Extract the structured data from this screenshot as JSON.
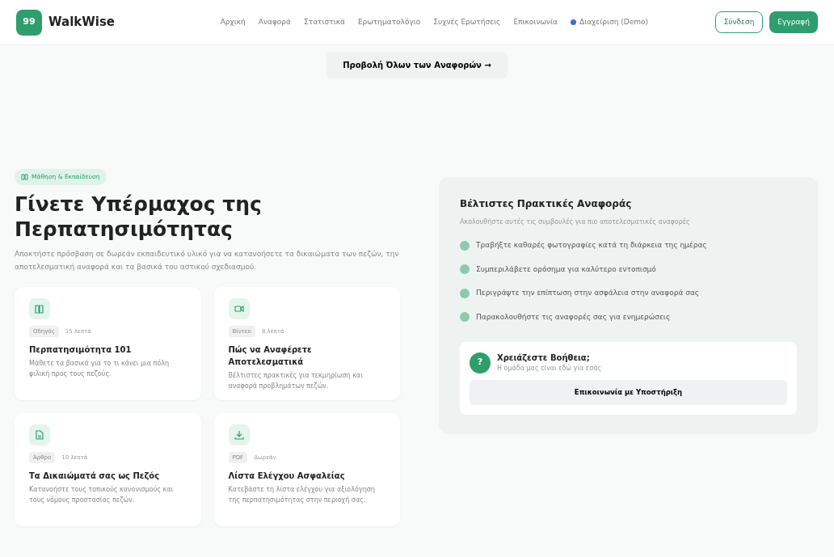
{
  "brand": {
    "name": "WalkWise",
    "logo_text": "99"
  },
  "nav": [
    {
      "label": "Αρχική",
      "selected": false
    },
    {
      "label": "Αναφορά",
      "selected": false
    },
    {
      "label": "Στατιστικά",
      "selected": false
    },
    {
      "label": "Ερωτηματολόγιο",
      "selected": false
    },
    {
      "label": "Συχνές Ερωτήσεις",
      "selected": false
    },
    {
      "label": "Επικοινωνία",
      "selected": false
    },
    {
      "label": "Διαχείριση (Demo)",
      "selected": false,
      "kind": "demo"
    }
  ],
  "auth_buttons": [
    {
      "label": "Σύνδεση",
      "kind": "outline"
    },
    {
      "label": "Εγγραφή",
      "kind": "solid"
    }
  ],
  "view_all_button": "Προβολή Όλων των Αναφορών →",
  "learn": {
    "badge": "Μάθηση & Εκπαίδευση",
    "title": "Γίνετε Υπέρμαχος της Περπατησιμότητας",
    "description": "Αποκτήστε πρόσβαση σε δωρεάν εκπαιδευτικό υλικό για να κατανοήσετε τα δικαιώματα των πεζών, την αποτελεσματική αναφορά και τα βασικά του αστικού σχεδιασμού.",
    "resources": [
      {
        "kind": "book",
        "tag": "Οδηγός",
        "meta": "15 λεπτά",
        "title": "Περπατησιμότητα 101",
        "description": "Μάθετε τα βασικά για το τι κάνει μια πόλη φιλική προς τους πεζούς."
      },
      {
        "kind": "video",
        "tag": "Βίντεο",
        "meta": "8 λεπτά",
        "title": "Πώς να Αναφέρετε Αποτελεσματικά",
        "description": "Βέλτιστες πρακτικές για τεκμηρίωση και αναφορά προβλημάτων πεζών."
      },
      {
        "kind": "document",
        "tag": "Άρθρο",
        "meta": "10 λεπτά",
        "title": "Τα Δικαιώματά σας ως Πεζός",
        "description": "Κατανοήστε τους τοπικούς κανονισμούς και τους νόμους προστασίας πεζών."
      },
      {
        "kind": "download",
        "tag": "PDF",
        "meta": "Δωρεάν",
        "title": "Λίστα Ελέγχου Ασφαλείας",
        "description": "Κατεβάστε τη λίστα ελέγχου για αξιολόγηση της περπατησιμότητας στην περιοχή σας."
      }
    ]
  },
  "tips": {
    "title": "Βέλτιστες Πρακτικές Αναφοράς",
    "subtitle": "Ακολουθήστε αυτές τις συμβουλές για πιο αποτελεσματικές αναφορές",
    "items": [
      "Τραβήξτε καθαρές φωτογραφίες κατά τη διάρκεια της ημέρας",
      "Συμπεριλάβετε ορόσημα για καλύτερο εντοπισμό",
      "Περιγράψτε την επίπτωση στην ασφάλεια στην αναφορά σας",
      "Παρακολουθήστε τις αναφορές σας για ενημερώσεις"
    ],
    "help": {
      "icon_text": "?",
      "title": "Χρειάζεστε Βοήθεια;",
      "subtitle": "Η ομάδα μας είναι εδώ για εσάς",
      "button": "Επικοινωνία με Υποστήριξη"
    }
  }
}
